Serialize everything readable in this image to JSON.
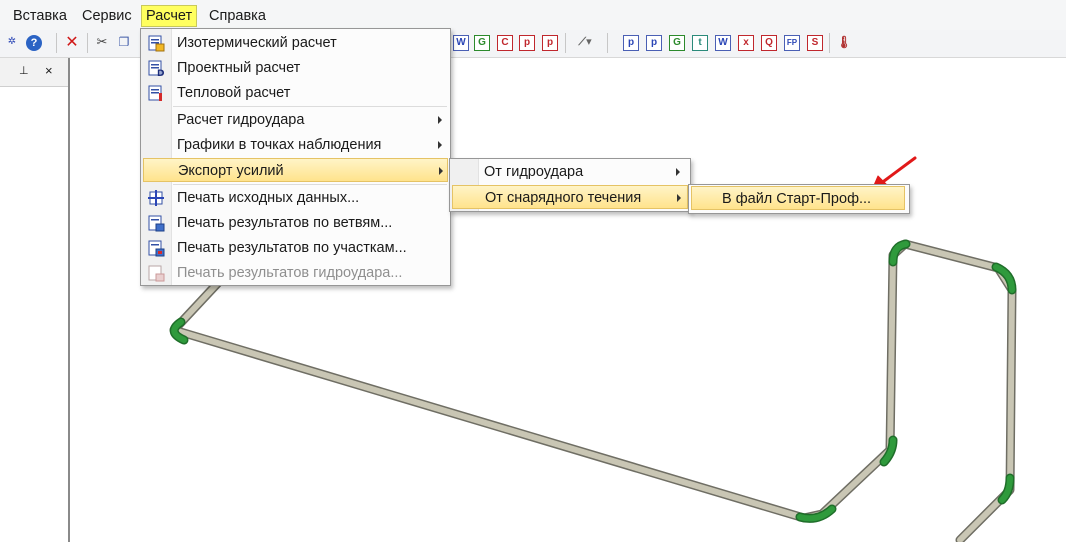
{
  "menubar": {
    "items": [
      {
        "label": "Вставка",
        "active": false
      },
      {
        "label": "Сервис",
        "active": false
      },
      {
        "label": "Расчет",
        "active": true
      },
      {
        "label": "Справка",
        "active": false
      }
    ]
  },
  "toolbar": {
    "icons_left": [
      "tools-icon",
      "help-icon",
      "delete-icon",
      "cut-icon",
      "copy-icon"
    ],
    "doc_buttons_1": [
      "W",
      "G",
      "C",
      "p",
      "p"
    ],
    "doc_buttons_2": [
      "p",
      "p",
      "G",
      "t",
      "W",
      "x",
      "Q",
      "FP",
      "S"
    ]
  },
  "left_pane": {
    "pin": "⊥",
    "close": "×"
  },
  "calc_menu": {
    "items": [
      {
        "label": "Изотермический расчет",
        "icon": "isothermal-calc-icon"
      },
      {
        "label": "Проектный расчет",
        "icon": "design-calc-icon"
      },
      {
        "label": "Тепловой расчет",
        "icon": "thermal-calc-icon"
      },
      {
        "label": "Расчет гидроудара",
        "submenu": true
      },
      {
        "label": "Графики в точках наблюдения",
        "submenu": true
      },
      {
        "label": "Экспорт усилий",
        "submenu": true,
        "highlighted": true
      },
      {
        "label": "Печать исходных данных...",
        "icon": "print-input-icon"
      },
      {
        "label": "Печать результатов по ветвям...",
        "icon": "print-branches-icon"
      },
      {
        "label": "Печать результатов по участкам...",
        "icon": "print-sections-icon"
      },
      {
        "label": "Печать результатов гидроудара...",
        "icon": "print-waterhammer-icon",
        "disabled": true
      }
    ]
  },
  "export_submenu": {
    "items": [
      {
        "label": "От гидроудара",
        "submenu": true
      },
      {
        "label": "От снарядного течения",
        "submenu": true,
        "highlighted": true
      }
    ]
  },
  "slug_submenu": {
    "items": [
      {
        "label": "В файл Старт-Проф...",
        "highlighted": true
      }
    ]
  },
  "colors": {
    "pipe": "#c9c6b4",
    "pipe_edge": "#6f6e64",
    "bend": "#2f9a3c",
    "arrow": "#e11919",
    "highlight": "#ffe38c"
  }
}
